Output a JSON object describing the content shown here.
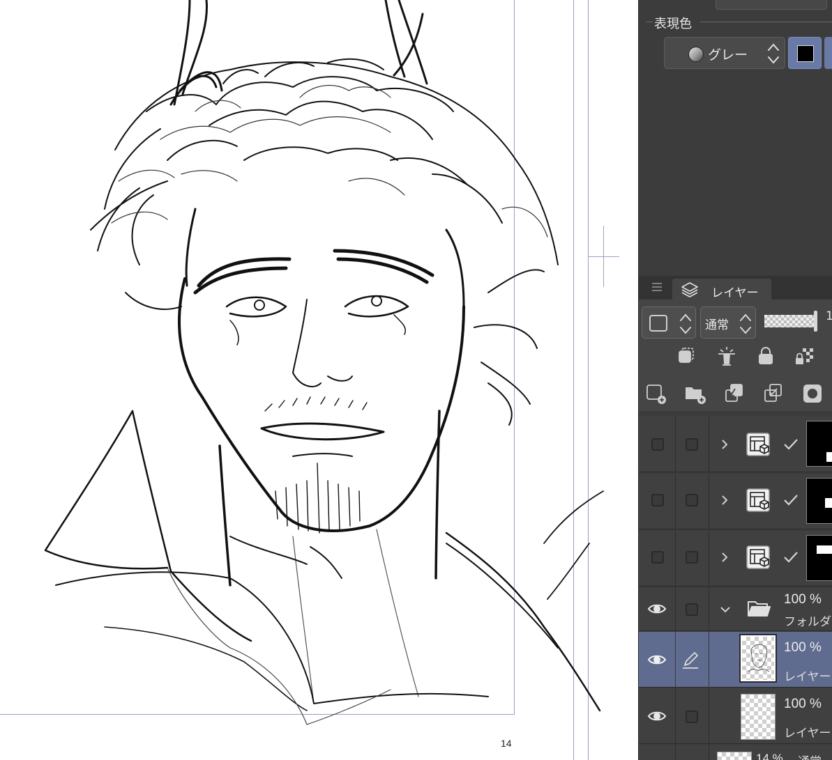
{
  "canvas": {
    "page_number": "14"
  },
  "panel": {
    "expression_color_label": "表現色",
    "color_mode": "グレー",
    "main_color": "#000000",
    "accent_color": "#6a7aa8"
  },
  "layer_panel": {
    "tab_label": "レイヤー",
    "blend_mode": "通常",
    "opacity_value": "1",
    "layers": [
      {
        "type": "reference",
        "expanded": false,
        "visible": false,
        "checked": true
      },
      {
        "type": "reference",
        "expanded": false,
        "visible": false,
        "checked": true
      },
      {
        "type": "reference",
        "expanded": false,
        "visible": false,
        "checked": true
      },
      {
        "type": "folder",
        "expanded": true,
        "visible": true,
        "opacity": "100 %",
        "name": "フォルダ"
      },
      {
        "type": "raster",
        "visible": true,
        "selected": true,
        "editing": true,
        "opacity": "100 %",
        "name": "レイヤー"
      },
      {
        "type": "raster",
        "visible": true,
        "selected": false,
        "opacity": "100 %",
        "name": "レイヤー"
      },
      {
        "type": "raster",
        "visible": true,
        "partial": true,
        "opacity": "14 %",
        "blend": "通常"
      }
    ]
  }
}
